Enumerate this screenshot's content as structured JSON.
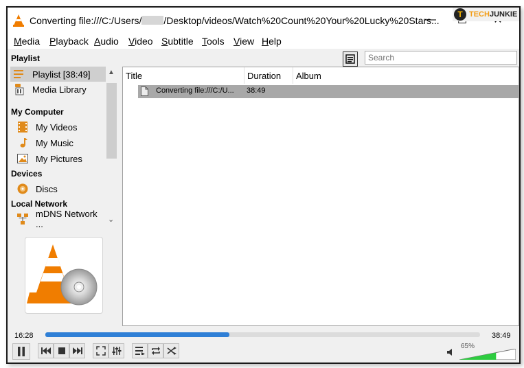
{
  "window": {
    "title_prefix": "Converting file:///C:/Users/",
    "title_suffix": "/Desktop/videos/Watch%20Count%20Your%20Lucky%20Stars...",
    "minimize": "—",
    "maximize": "☐",
    "close": "✕"
  },
  "watermark": {
    "logo": "T",
    "part1": "TECH",
    "part2": "JUNKIE"
  },
  "menu": [
    "Media",
    "Playback",
    "Audio",
    "Video",
    "Subtitle",
    "Tools",
    "View",
    "Help"
  ],
  "sidebar": {
    "sections": {
      "playlist": "Playlist",
      "my_computer": "My Computer",
      "devices": "Devices",
      "local_network": "Local Network"
    },
    "items": {
      "playlist": "Playlist [38:49]",
      "media_library": "Media Library",
      "my_videos": "My Videos",
      "my_music": "My Music",
      "my_pictures": "My Pictures",
      "discs": "Discs",
      "mdns": "mDNS Network ..."
    }
  },
  "search": {
    "placeholder": "Search"
  },
  "playlist_table": {
    "columns": {
      "title": "Title",
      "duration": "Duration",
      "album": "Album"
    },
    "rows": [
      {
        "title": "Converting file:///C:/U...",
        "duration": "38:49",
        "album": ""
      }
    ]
  },
  "player": {
    "elapsed": "16:28",
    "total": "38:49",
    "progress": 0.424,
    "volume_label": "65%",
    "volume": 0.65
  },
  "colors": {
    "accent": "#2f7fd6",
    "volume": "#2ecc40",
    "selection": "#a8a8a8",
    "vlc_orange": "#f07d00"
  }
}
